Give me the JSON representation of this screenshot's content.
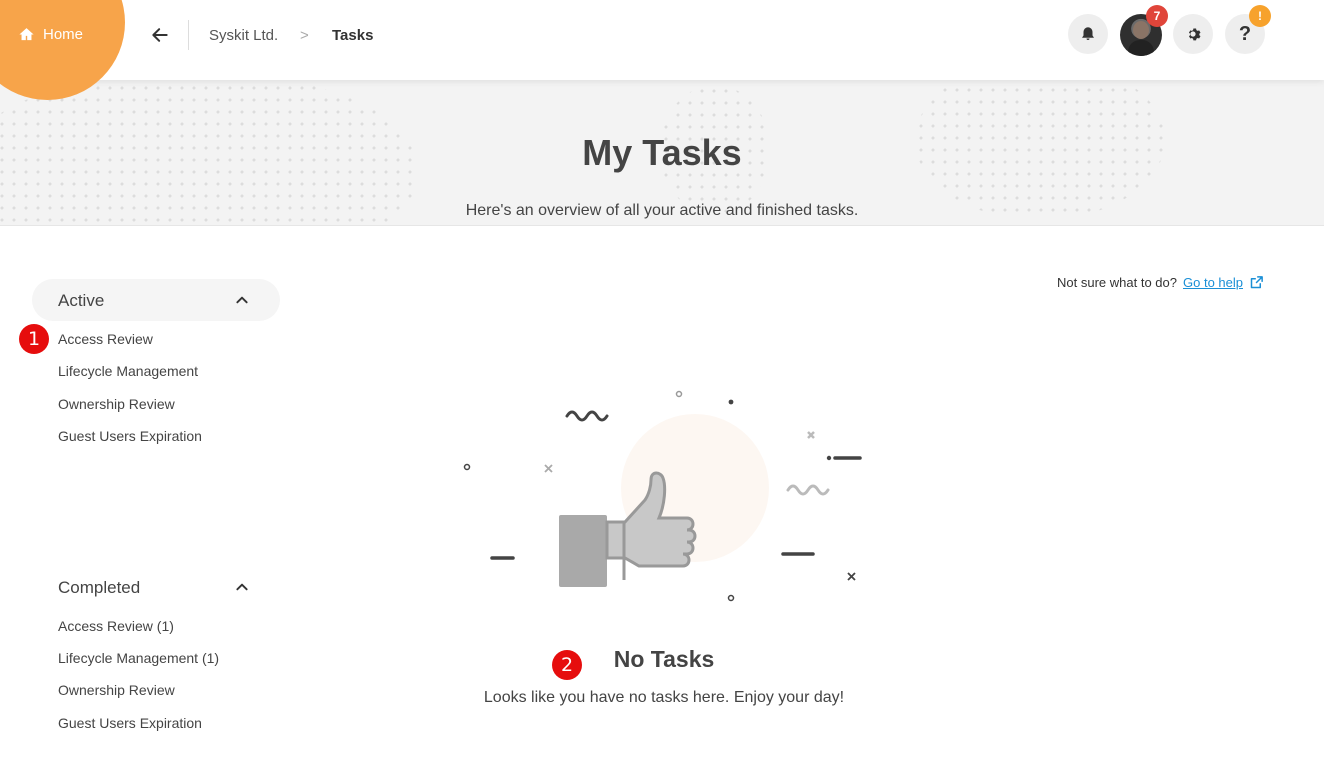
{
  "topbar": {
    "home_label": "Home",
    "breadcrumb_org": "Syskit Ltd.",
    "breadcrumb_sep": ">",
    "breadcrumb_current": "Tasks",
    "avatar_badge": "7",
    "help_badge": "!",
    "help_label": "?"
  },
  "hero": {
    "title": "My Tasks",
    "subtitle": "Here's an overview of all your active and finished tasks."
  },
  "sidebar": {
    "active_label": "Active",
    "active_items": [
      "Access Review",
      "Lifecycle Management",
      "Ownership Review",
      "Guest Users Expiration"
    ],
    "completed_label": "Completed",
    "completed_items": [
      "Access Review (1)",
      "Lifecycle Management (1)",
      "Ownership Review",
      "Guest Users Expiration"
    ]
  },
  "help": {
    "prompt": "Not sure what to do?",
    "link": "Go to help"
  },
  "empty_state": {
    "title": "No Tasks",
    "subtitle": "Looks like you have no tasks here. Enjoy your day!"
  },
  "markers": [
    "1",
    "2"
  ],
  "colors": {
    "brand_orange": "#f7a44a",
    "badge_red": "#e0453a",
    "badge_orange": "#f7a22c",
    "link_blue": "#1a8fd6",
    "marker_red": "#e60d0d"
  }
}
